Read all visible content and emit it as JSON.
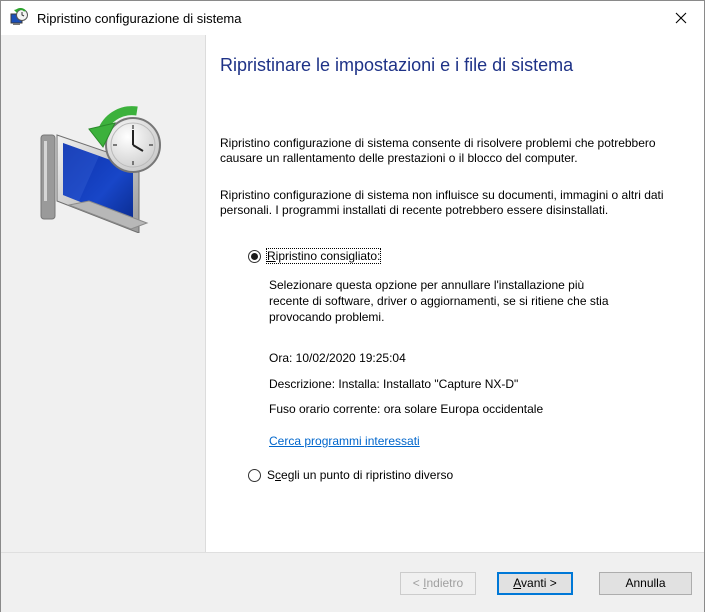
{
  "window": {
    "title": "Ripristino configurazione di sistema",
    "close_glyph": "✕"
  },
  "main": {
    "heading": "Ripristinare le impostazioni e i file di sistema",
    "paragraph1": "Ripristino configurazione di sistema consente di risolvere problemi che potrebbero causare un rallentamento delle prestazioni o il blocco del computer.",
    "paragraph2": "Ripristino configurazione di sistema non influisce su documenti, immagini o altri dati personali. I programmi installati di recente potrebbero essere disinstallati.",
    "options": [
      {
        "label_accel": "R",
        "label_rest": "ipristino consigliato:",
        "selected": true,
        "description": "Selezionare questa opzione per annullare l'installazione più recente di software, driver o aggiornamenti, se si ritiene che stia provocando problemi."
      },
      {
        "label_first": "S",
        "label_accel": "c",
        "label_rest": "egli un punto di ripristino diverso",
        "selected": false
      }
    ],
    "info": {
      "time": "Ora: 10/02/2020 19:25:04",
      "description": "Descrizione: Installa: Installato \"Capture NX-D\"",
      "timezone": "Fuso orario corrente: ora solare Europa occidentale"
    },
    "link": "Cerca programmi interessati"
  },
  "footer": {
    "back": {
      "prefix": "< ",
      "accel": "I",
      "rest": "ndietro"
    },
    "next": {
      "accel": "A",
      "rest": "vanti >"
    },
    "cancel": "Annulla"
  },
  "colors": {
    "heading": "#1e3287",
    "link": "#0066cc",
    "focus_border": "#0078d7"
  },
  "icons": [
    "system-restore-title-icon",
    "close-icon",
    "system-restore-hero-icon"
  ]
}
